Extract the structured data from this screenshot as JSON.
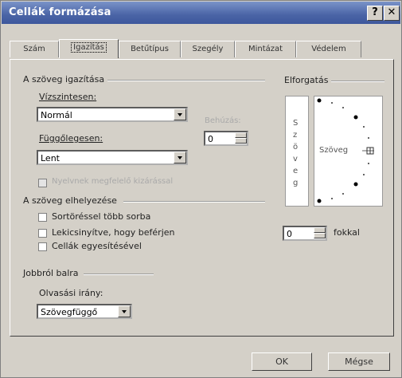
{
  "window": {
    "title": "Cellák formázása",
    "help_glyph": "?",
    "close_glyph": "✕"
  },
  "tabs": [
    {
      "label": "Szám",
      "active": false
    },
    {
      "label": "Igazítás",
      "active": true
    },
    {
      "label": "Betűtípus",
      "active": false
    },
    {
      "label": "Szegély",
      "active": false
    },
    {
      "label": "Mintázat",
      "active": false
    },
    {
      "label": "Védelem",
      "active": false
    }
  ],
  "alignment": {
    "group_label": "A szöveg igazítása",
    "horizontal_label": "Vízszintesen:",
    "horizontal_value": "Normál",
    "indent_label": "Behúzás:",
    "indent_value": "0",
    "vertical_label": "Függőlegesen:",
    "vertical_value": "Lent",
    "justify_distributed_label": "Nyelvnek megfelelő kizárással"
  },
  "text_control": {
    "group_label": "A szöveg elhelyezése",
    "wrap_text_label": "Sortöréssel több sorba",
    "shrink_to_fit_label": "Lekicsinyítve, hogy beférjen",
    "merge_cells_label": "Cellák egyesítésével"
  },
  "rtl": {
    "group_label": "Jobbról balra",
    "direction_label": "Olvasási irány:",
    "direction_value": "Szövegfüggő"
  },
  "orientation": {
    "group_label": "Elforgatás",
    "vertical_letters": [
      "S",
      "z",
      "ö",
      "v",
      "e",
      "g"
    ],
    "dial_text": "Szöveg",
    "degrees_value": "0",
    "degrees_label": "fokkal"
  },
  "buttons": {
    "ok": "OK",
    "cancel": "Mégse"
  }
}
